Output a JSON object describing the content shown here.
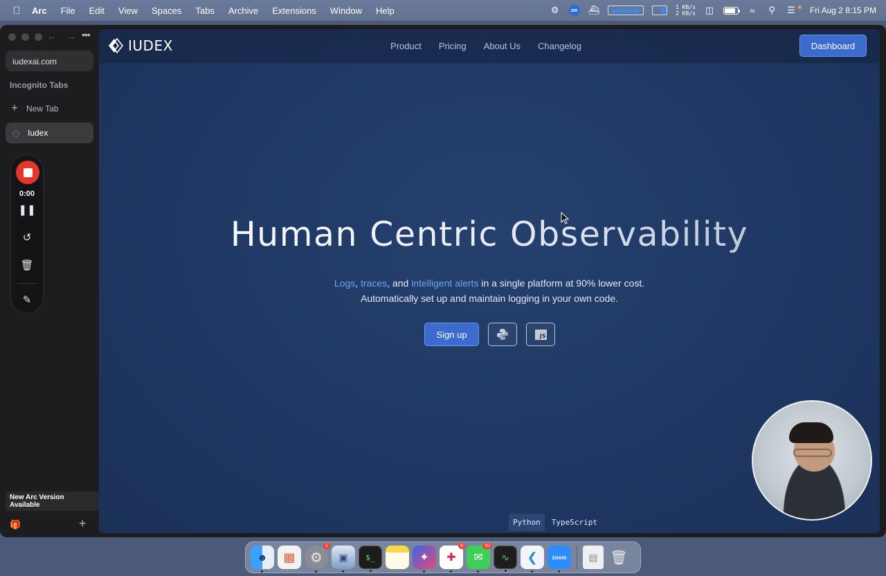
{
  "menubar": {
    "app_name": "Arc",
    "items": [
      "File",
      "Edit",
      "View",
      "Spaces",
      "Tabs",
      "Archive",
      "Extensions",
      "Window",
      "Help"
    ],
    "net_up": "1 KB/s",
    "net_down": "2 KB/s",
    "zoom_badge": "zm",
    "datetime": "Fri Aug 2  8:15 PM",
    "battery_level": 0.85
  },
  "sidebar": {
    "url": "iudexai.com",
    "section_label": "Incognito Tabs",
    "new_tab_label": "New Tab",
    "active_tab_label": "Iudex",
    "recorder_time": "0:00",
    "update_label": "New Arc Version Available"
  },
  "site": {
    "logo_text": "IUDEX",
    "nav": [
      "Product",
      "Pricing",
      "About Us",
      "Changelog"
    ],
    "dashboard_label": "Dashboard",
    "hero_title": "Human Centric Observability",
    "hero_sub": {
      "hl1": "Logs",
      "sep1": ", ",
      "hl2": "traces",
      "sep2": ", and ",
      "hl3": "intelligent alerts",
      "rest": " in a single platform at 90% lower cost.",
      "line2": "Automatically set up and maintain logging in your own code."
    },
    "signup_label": "Sign up",
    "js_label": "JS",
    "code_tabs": [
      "Python",
      "TypeScript"
    ],
    "accent_color": "#3b6bcf",
    "highlight_color": "#6ea2f5"
  },
  "dock": {
    "apps": [
      {
        "name": "finder-icon",
        "badge": ""
      },
      {
        "name": "launchpad-icon",
        "badge": ""
      },
      {
        "name": "system-settings-icon",
        "badge": "1"
      },
      {
        "name": "preview-icon",
        "badge": ""
      },
      {
        "name": "terminal-icon",
        "badge": ""
      },
      {
        "name": "notes-icon",
        "badge": ""
      },
      {
        "name": "arc-icon",
        "badge": ""
      },
      {
        "name": "slack-icon",
        "badge": "6"
      },
      {
        "name": "messages-icon",
        "badge": "50"
      },
      {
        "name": "activity-monitor-icon",
        "badge": ""
      },
      {
        "name": "vscode-icon",
        "badge": ""
      },
      {
        "name": "zoom-icon",
        "badge": ""
      }
    ],
    "zoom_label": "zoom"
  }
}
